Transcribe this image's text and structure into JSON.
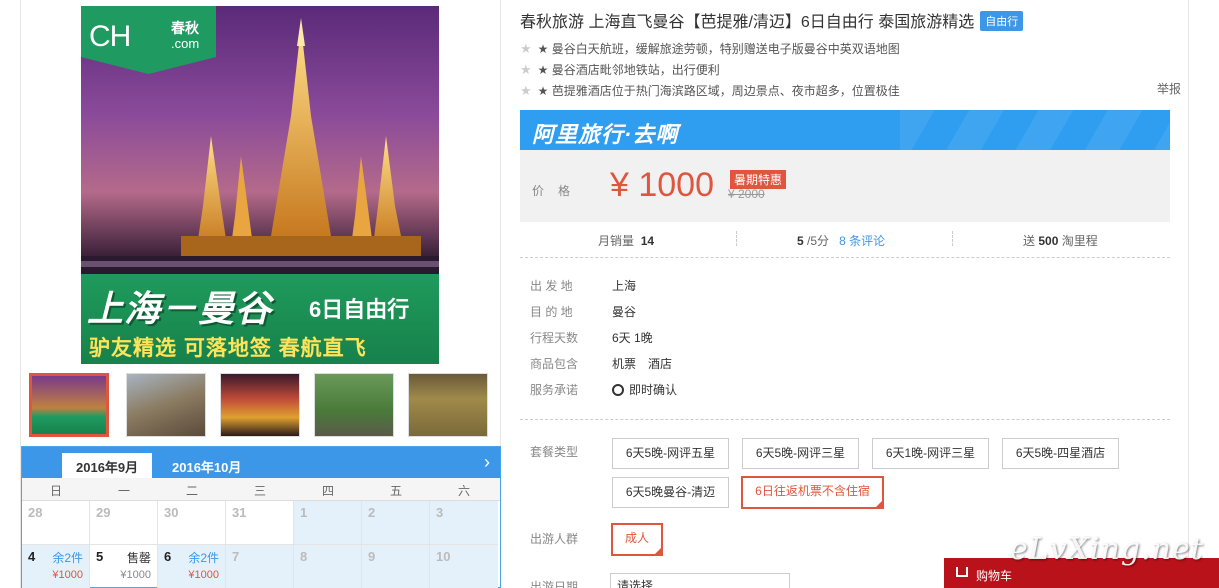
{
  "product": {
    "title": "春秋旅游 上海直飞曼谷【芭提雅/清迈】6日自由行 泰国旅游精选",
    "badge": "自由行",
    "features": [
      "★ 曼谷白天航班，缓解旅途劳顿，特别赠送电子版曼谷中英双语地图",
      "★ 曼谷酒店毗邻地铁站，出行便利",
      "★ 芭提雅酒店位于热门海滨路区域，周边景点、夜市超多，位置极佳"
    ],
    "report": "举报"
  },
  "main_image": {
    "logo_latin": "CH",
    "logo_cn": "春秋",
    "logo_com": ".com",
    "route": "上海－曼谷",
    "days": "6日自由行",
    "slogan": "驴友精选 可落地签 春航直飞"
  },
  "promo": {
    "brand": "阿里旅行·去啊",
    "price_label": "价格",
    "price": "¥ 1000",
    "tag": "暑期特惠",
    "old_price": "¥ 2000"
  },
  "stats": {
    "sales_label": "月销量",
    "sales": "14",
    "rating": "5",
    "rating_suffix": "/5分",
    "reviews": "8 条评论",
    "points_prefix": "送",
    "points": "500",
    "points_suffix": "淘里程"
  },
  "info": [
    {
      "k": "出 发 地",
      "v": "上海"
    },
    {
      "k": "目 的 地",
      "v": "曼谷"
    },
    {
      "k": "行程天数",
      "v": "6天 1晚"
    },
    {
      "k": "商品包含",
      "v": "机票　酒店"
    },
    {
      "k": "服务承诺",
      "v": "即时确认"
    }
  ],
  "packages": {
    "label": "套餐类型",
    "options": [
      "6天5晚-网评五星",
      "6天5晚-网评三星",
      "6天1晚-网评三星",
      "6天5晚-四星酒店",
      "6天5晚曼谷-清迈",
      "6日往返机票不含住宿"
    ]
  },
  "crowd": {
    "label": "出游人群",
    "option": "成人"
  },
  "date": {
    "label": "出游日期",
    "value": "请选择"
  },
  "cart": {
    "label": "购物车"
  },
  "watermark": "eLvXing.net",
  "calendar": {
    "tab_active": "2016年9月",
    "tab_next": "2016年10月",
    "weekdays": [
      "日",
      "一",
      "二",
      "三",
      "四",
      "五",
      "六"
    ],
    "row1": [
      "28",
      "29",
      "30",
      "31",
      "1",
      "2",
      "3"
    ],
    "row2": [
      {
        "d": "4",
        "st": "余2件",
        "pr": "¥1000"
      },
      {
        "d": "5",
        "st": "售罄",
        "pr": "¥1000"
      },
      {
        "d": "6",
        "st": "余2件",
        "pr": "¥1000"
      },
      {
        "d": "7"
      },
      {
        "d": "8"
      },
      {
        "d": "9"
      },
      {
        "d": "10"
      }
    ]
  },
  "colors": {
    "accent": "#3c97e8",
    "price": "#e0553d",
    "brand_green": "#1f9b62",
    "cart": "#b9121b"
  }
}
